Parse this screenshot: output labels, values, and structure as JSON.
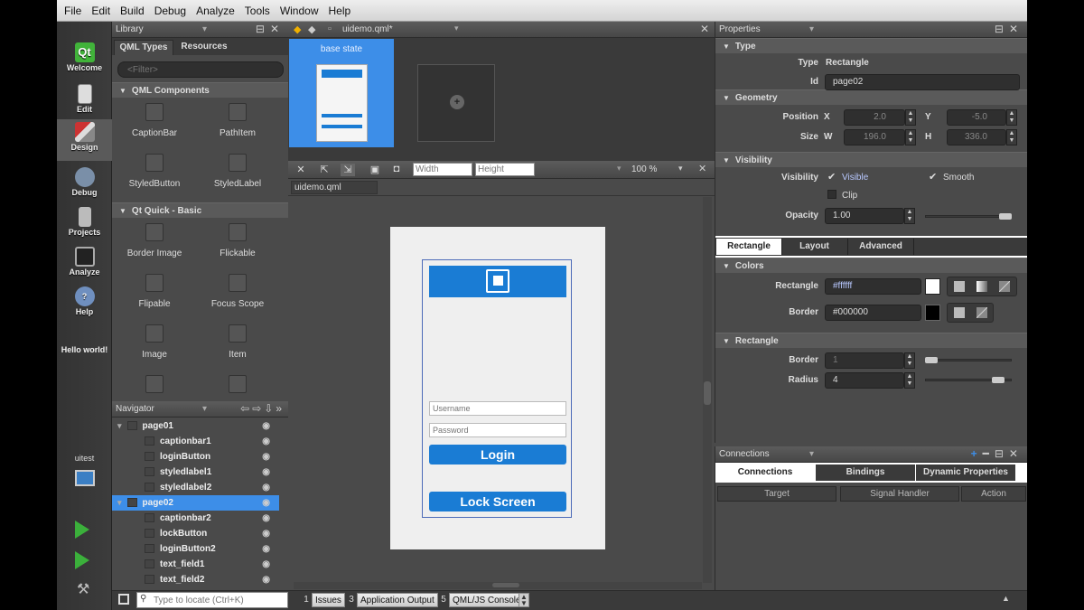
{
  "menu": [
    "File",
    "Edit",
    "Build",
    "Debug",
    "Analyze",
    "Tools",
    "Window",
    "Help"
  ],
  "modes": [
    {
      "label": "Welcome",
      "icon": "qt-logo-icon"
    },
    {
      "label": "Edit",
      "icon": "document-icon"
    },
    {
      "label": "Design",
      "icon": "brush-icon"
    },
    {
      "label": "Debug",
      "icon": "bug-icon"
    },
    {
      "label": "Projects",
      "icon": "wrench-icon"
    },
    {
      "label": "Analyze",
      "icon": "monitor-icon"
    },
    {
      "label": "Help",
      "icon": "help-icon"
    }
  ],
  "hello": "Hello world!",
  "kit_label": "uitest",
  "library": {
    "title": "Library",
    "tabs": [
      "QML Types",
      "Resources"
    ],
    "filter_placeholder": "<Filter>",
    "section1": "QML Components",
    "section2": "Qt Quick - Basic",
    "items1": [
      "CaptionBar",
      "PathItem",
      "StyledButton",
      "StyledLabel"
    ],
    "items2": [
      "Border Image",
      "Flickable",
      "Flipable",
      "Focus Scope",
      "Image",
      "Item"
    ]
  },
  "navigator": {
    "title": "Navigator",
    "rows": [
      {
        "label": "page01",
        "level": 0
      },
      {
        "label": "captionbar1",
        "level": 1
      },
      {
        "label": "loginButton",
        "level": 1
      },
      {
        "label": "styledlabel1",
        "level": 1
      },
      {
        "label": "styledlabel2",
        "level": 1
      },
      {
        "label": "page02",
        "level": 0
      },
      {
        "label": "captionbar2",
        "level": 1
      },
      {
        "label": "lockButton",
        "level": 1
      },
      {
        "label": "loginButton2",
        "level": 1
      },
      {
        "label": "text_field1",
        "level": 1
      },
      {
        "label": "text_field2",
        "level": 1
      }
    ]
  },
  "editor": {
    "file": "uidemo.qml*",
    "state_label": "base state",
    "width_placeholder": "Width",
    "height_placeholder": "Height",
    "zoom": "100 %",
    "canvas_tab": "uidemo.qml",
    "form": {
      "username_placeholder": "Username",
      "password_placeholder": "Password",
      "login": "Login",
      "lock": "Lock Screen"
    }
  },
  "properties": {
    "title": "Properties",
    "type_section": "Type",
    "type_label": "Type",
    "type_value": "Rectangle",
    "id_label": "Id",
    "id_value": "page02",
    "geometry_section": "Geometry",
    "position_label": "Position",
    "size_label": "Size",
    "x_label": "X",
    "y_label": "Y",
    "w_label": "W",
    "h_label": "H",
    "x": "2.0",
    "y": "-5.0",
    "w": "196.0",
    "h": "336.0",
    "visibility_section": "Visibility",
    "visibility_label": "Visibility",
    "visible": "Visible",
    "smooth": "Smooth",
    "clip": "Clip",
    "opacity_label": "Opacity",
    "opacity": "1.00",
    "tabs": [
      "Rectangle",
      "Layout",
      "Advanced"
    ],
    "colors_section": "Colors",
    "rect_color_label": "Rectangle",
    "rect_color": "#ffffff",
    "border_color_label": "Border",
    "border_color": "#000000",
    "rect_section": "Rectangle",
    "border_label": "Border",
    "border": "1",
    "radius_label": "Radius",
    "radius": "4",
    "opacity_level": 1.0,
    "border_level": 0.0,
    "radius_level": 0.9
  },
  "connections": {
    "title": "Connections",
    "tabs": [
      "Connections",
      "Bindings",
      "Dynamic Properties"
    ],
    "columns": [
      "Target",
      "Signal Handler",
      "Action"
    ]
  },
  "bottom": {
    "locate_placeholder": "Type to locate (Ctrl+K)",
    "panes": [
      {
        "num": "1",
        "label": "Issues"
      },
      {
        "num": "3",
        "label": "Application Output"
      },
      {
        "num": "5",
        "label": "QML/JS Console"
      }
    ]
  },
  "colors": {
    "accent": "#1a7cd4",
    "selection": "#3d8ee8"
  }
}
